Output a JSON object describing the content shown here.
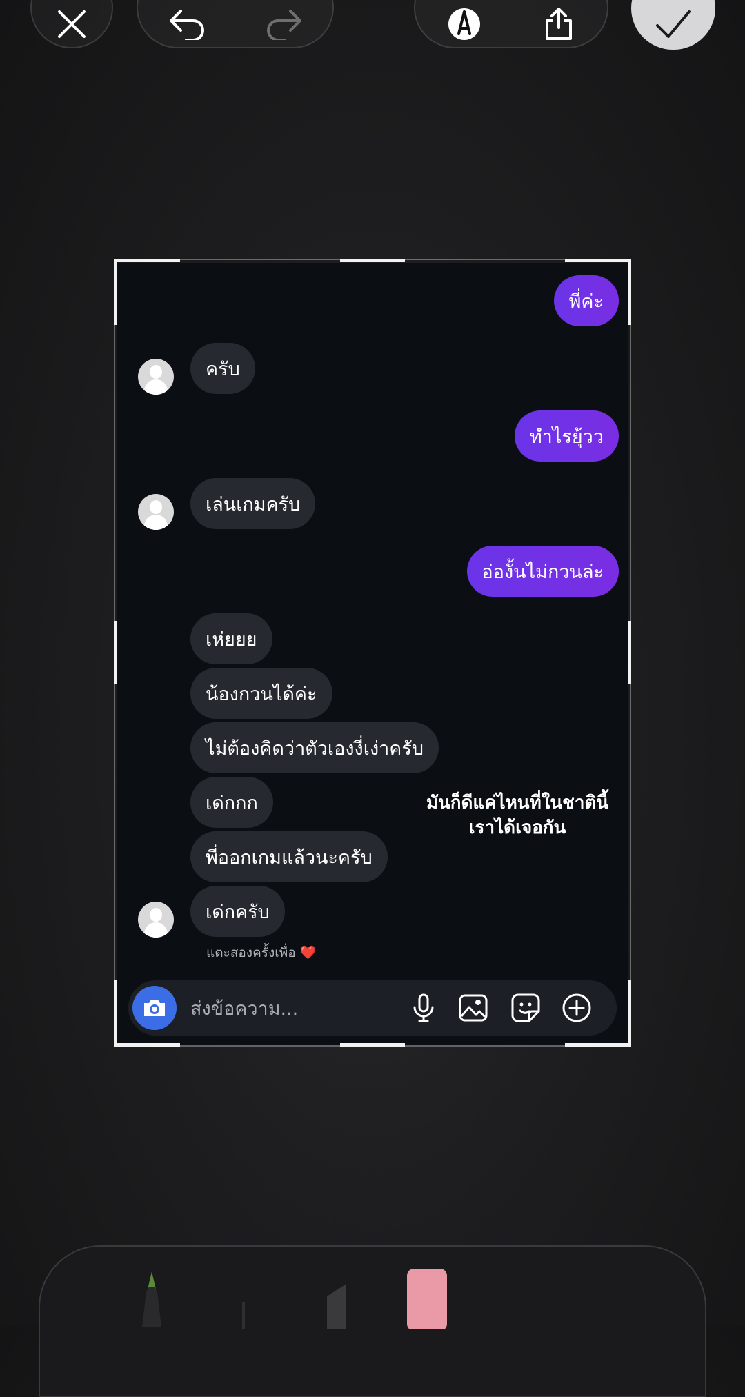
{
  "toolbar": {
    "close_icon": "close-icon",
    "undo_icon": "undo-icon",
    "redo_icon": "redo-icon",
    "markup_icon": "pen-markup-icon",
    "share_icon": "share-icon",
    "done_icon": "checkmark-icon"
  },
  "chat": {
    "messages": [
      {
        "side": "out",
        "text": "พี่ค่ะ"
      },
      {
        "side": "in",
        "text": "ครับ"
      },
      {
        "side": "out",
        "text": "ทำไรยุ้วว"
      },
      {
        "side": "in",
        "text": "เล่นเกมครับ"
      },
      {
        "side": "out",
        "text": "อ่องั้นไม่กวนล่ะ"
      },
      {
        "side": "in",
        "text": "เห่ยยย"
      },
      {
        "side": "in",
        "text": "น้องกวนได้ค่ะ"
      },
      {
        "side": "in",
        "text": "ไม่ต้องคิดว่าตัวเองงี่เง่าครับ"
      },
      {
        "side": "in",
        "text": "เด่กกก"
      },
      {
        "side": "in",
        "text": "พี่ออกเกมแล้วนะครับ"
      },
      {
        "side": "in",
        "text": "เด่กครับ"
      }
    ],
    "overlay_line1": "มันก็ดีแค่ไหนที่ในชาตินี้",
    "overlay_line2": "เราได้เจอกัน",
    "tap_hint": "แตะสองครั้งเพื่อ",
    "tap_hint_heart": "❤️",
    "composer": {
      "placeholder": "ส่งข้อความ...",
      "camera_icon": "camera-icon",
      "mic_icon": "mic-icon",
      "image_icon": "image-icon",
      "sticker_icon": "sticker-icon",
      "plus_icon": "plus-icon"
    }
  },
  "colors": {
    "outgoing_bubble": "#6c33e6",
    "incoming_bubble": "#262a30",
    "chat_background": "#0b0f14",
    "camera_button": "#3b6ee6"
  }
}
